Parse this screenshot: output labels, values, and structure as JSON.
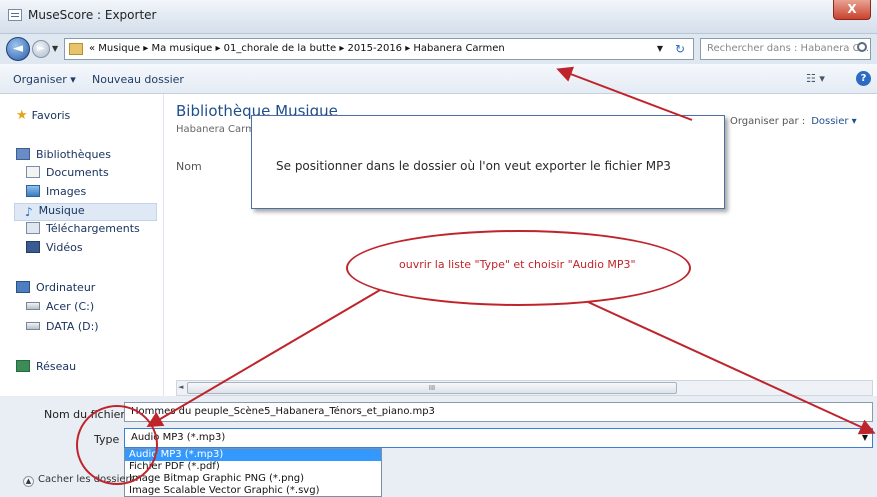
{
  "window": {
    "title": "MuseScore : Exporter",
    "close": "X"
  },
  "address": {
    "crumbs": "« Musique  ▸  Ma musique  ▸  01_chorale de la butte  ▸  2015-2016  ▸  Habanera Carmen",
    "search_placeholder": "Rechercher dans : Habanera C..."
  },
  "toolbar": {
    "organize": "Organiser ▾",
    "new_folder": "Nouveau dossier",
    "view": "☷ ▾",
    "help": "?"
  },
  "nav": {
    "favorites": "Favoris",
    "libraries": "Bibliothèques",
    "documents": "Documents",
    "images": "Images",
    "music": "Musique",
    "downloads": "Téléchargements",
    "videos": "Vidéos",
    "computer": "Ordinateur",
    "drive_c": "Acer (C:)",
    "drive_d": "DATA (D:)",
    "network": "Réseau"
  },
  "main": {
    "library_title": "Bibliothèque Musique",
    "library_sub": "Habanera Carm",
    "col_name": "Nom",
    "arrange_label": "Organiser par :",
    "arrange_value": "Dossier ▾",
    "scroll_label": "III"
  },
  "annotations": {
    "callout": "Se positionner dans le dossier où l'on veut exporter le fichier MP3",
    "ellipse": "ouvrir la liste \"Type\" et choisir \"Audio MP3\""
  },
  "form": {
    "file_name_label": "Nom du fichier :",
    "file_name_value": "Hommes du peuple_Scène5_Habanera_Ténors_et_piano.mp3",
    "type_label": "Type :",
    "type_value": "Audio MP3 (*.mp3)",
    "options": [
      "Audio MP3 (*.mp3)",
      "Fichier PDF (*.pdf)",
      "Image Bitmap Graphic PNG (*.png)",
      "Image Scalable Vector Graphic (*.svg)"
    ],
    "hide_folders": "Cacher les dossiers"
  }
}
